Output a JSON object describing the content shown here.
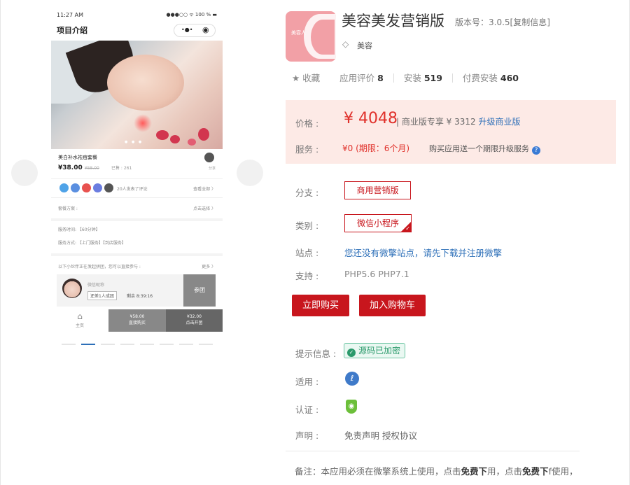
{
  "phone": {
    "time": "11:27 AM",
    "status_right": "●●●○○ ᯤ 100 % ▬",
    "title": "项目介绍",
    "capsule_more": "•●•",
    "capsule_close": "◉",
    "banner_dots": "● ● ●",
    "product_name": "美白补水祛痘套餐",
    "price": "¥38.00",
    "orig_price": "¥58.00",
    "sold": "已售 : 261",
    "share": "分享",
    "reviews": "20人发表了评论",
    "view_all": "查看全部 〉",
    "plan": "套餐方案 :",
    "choose": "点击选择 〉",
    "service_time": "服务时间: 【60分钟】",
    "service_mode": "服务方式: 【上门服务】【到店服务】",
    "group_tip": "以下小伙伴正在发起拼团，您可以直接参与 :",
    "more": "更多 〉",
    "member_name": "微信昵称",
    "member_need": "还差1人成团",
    "member_left": "剩余 8:39:16",
    "join": "参团",
    "home": "主页",
    "buy_direct_price": "¥58.00",
    "buy_direct": "直接购买",
    "group_price": "¥32.00",
    "group_start": "点击开团"
  },
  "app": {
    "logo_text": "美容人",
    "title": "美容美发营销版",
    "version": "版本号：3.0.5[复制信息]",
    "tag": "美容",
    "favorite": "★  收藏",
    "rating_label": "应用评价",
    "rating": "8",
    "install_label": "安装",
    "install": "519",
    "paid_label": "付费安装",
    "paid": "460"
  },
  "price": {
    "label": "价格 :",
    "amount": "¥ 4048",
    "rest": "| 商业版专享 ¥ 3312",
    "upgrade": "升级商业版",
    "service_label": "服务 :",
    "service_value": "¥0 (期限：6个月)",
    "service_note": "购买应用送一个期限升级服务",
    "help": "?"
  },
  "details": {
    "branch_label": "分支 :",
    "branch_value": "商用营销版",
    "category_label": "类别 :",
    "category_value": "微信小程序",
    "site_label": "站点 :",
    "site_value": "您还没有微擎站点，请先下载并注册微擎",
    "support_label": "支持 :",
    "support_value": "PHP5.6   PHP7.1",
    "buy_now": "立即购买",
    "add_cart": "加入购物车",
    "tip_label": "提示信息 :",
    "tip_value": "源码已加密",
    "apply_label": "适用 :",
    "cert_label": "认证 :",
    "statement_label": "声明 :",
    "statement_value": "免责声明  授权协议",
    "note_text_1": "备注：本应用必须在微擎系统上使用，点击",
    "note_bold_1": "免费下",
    "note_text_2": "用，点击",
    "note_bold_2": "免费下",
    "note_text_3": "f使用，"
  }
}
